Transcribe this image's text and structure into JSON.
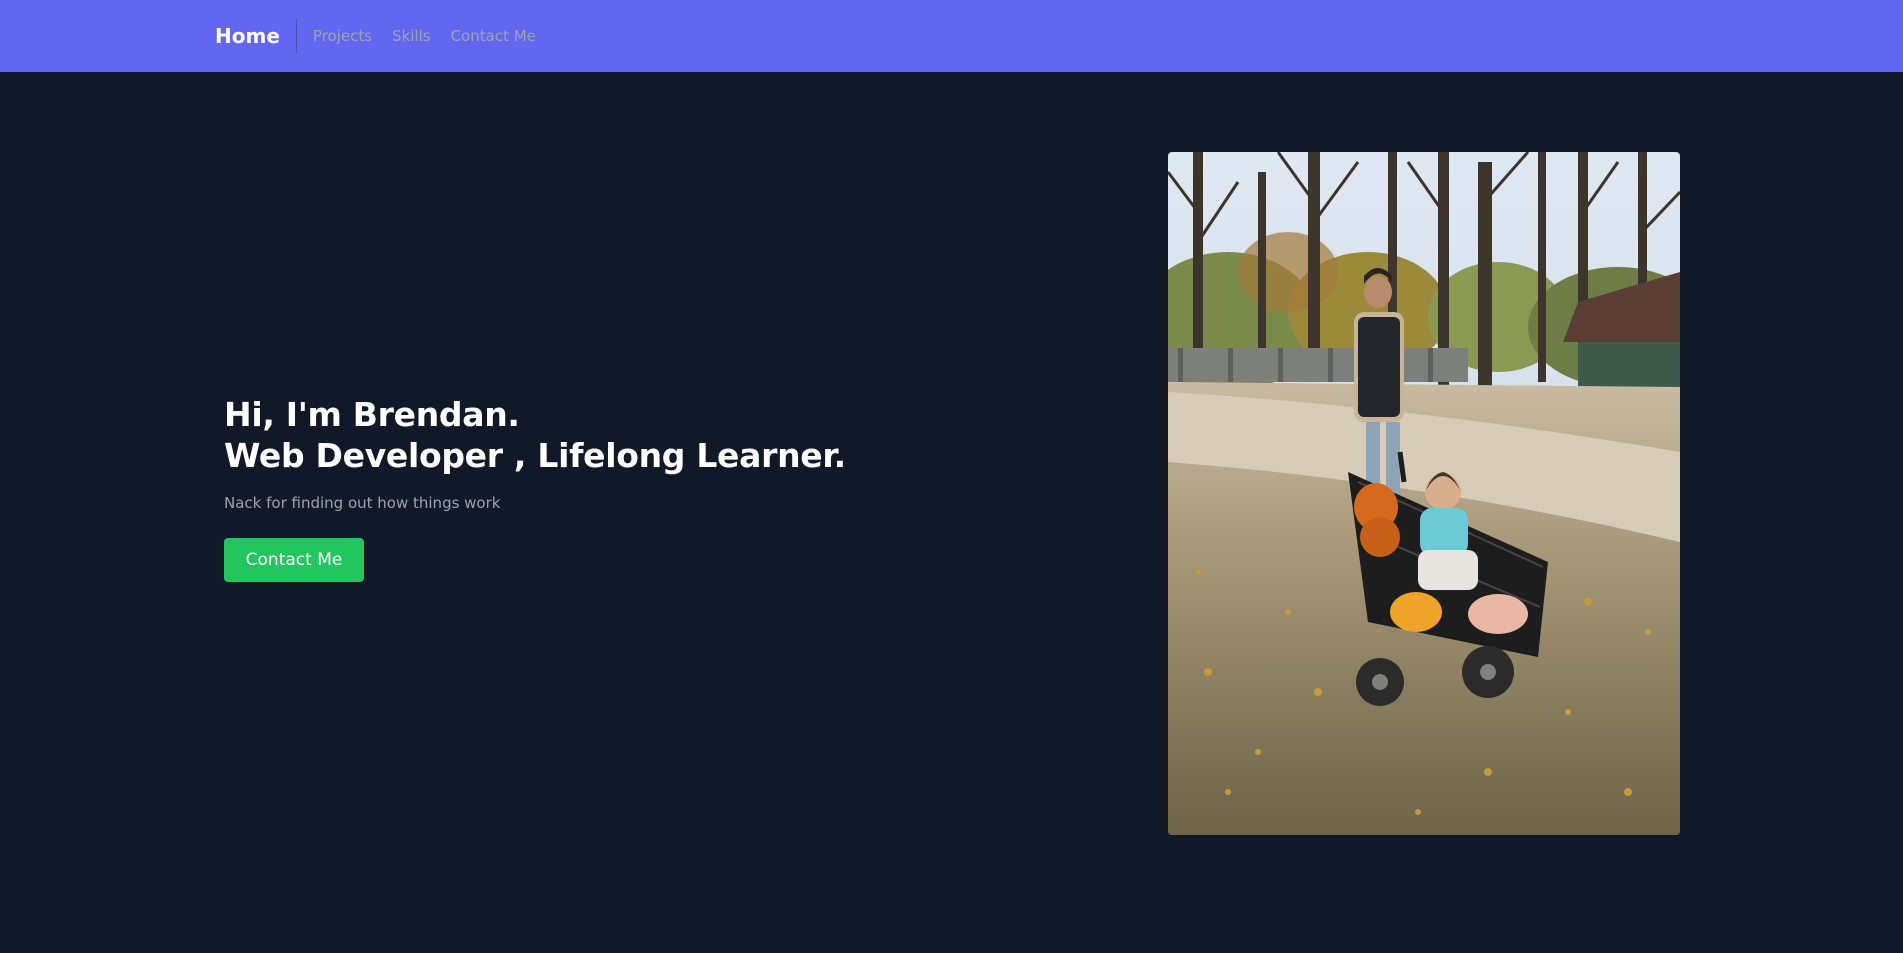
{
  "nav": {
    "brand": "Home",
    "links": [
      "Projects",
      "Skills",
      "Contact Me"
    ]
  },
  "hero": {
    "title_line1": "Hi, I'm Brendan.",
    "title_line2": "Web Developer , Lifelong Learner.",
    "subtitle": "Nack for finding out how things work",
    "cta_label": "Contact Me"
  },
  "colors": {
    "nav_bg": "#6366f1",
    "page_bg": "#111827",
    "cta_bg": "#22c55e",
    "muted_text": "#9ca3af"
  }
}
